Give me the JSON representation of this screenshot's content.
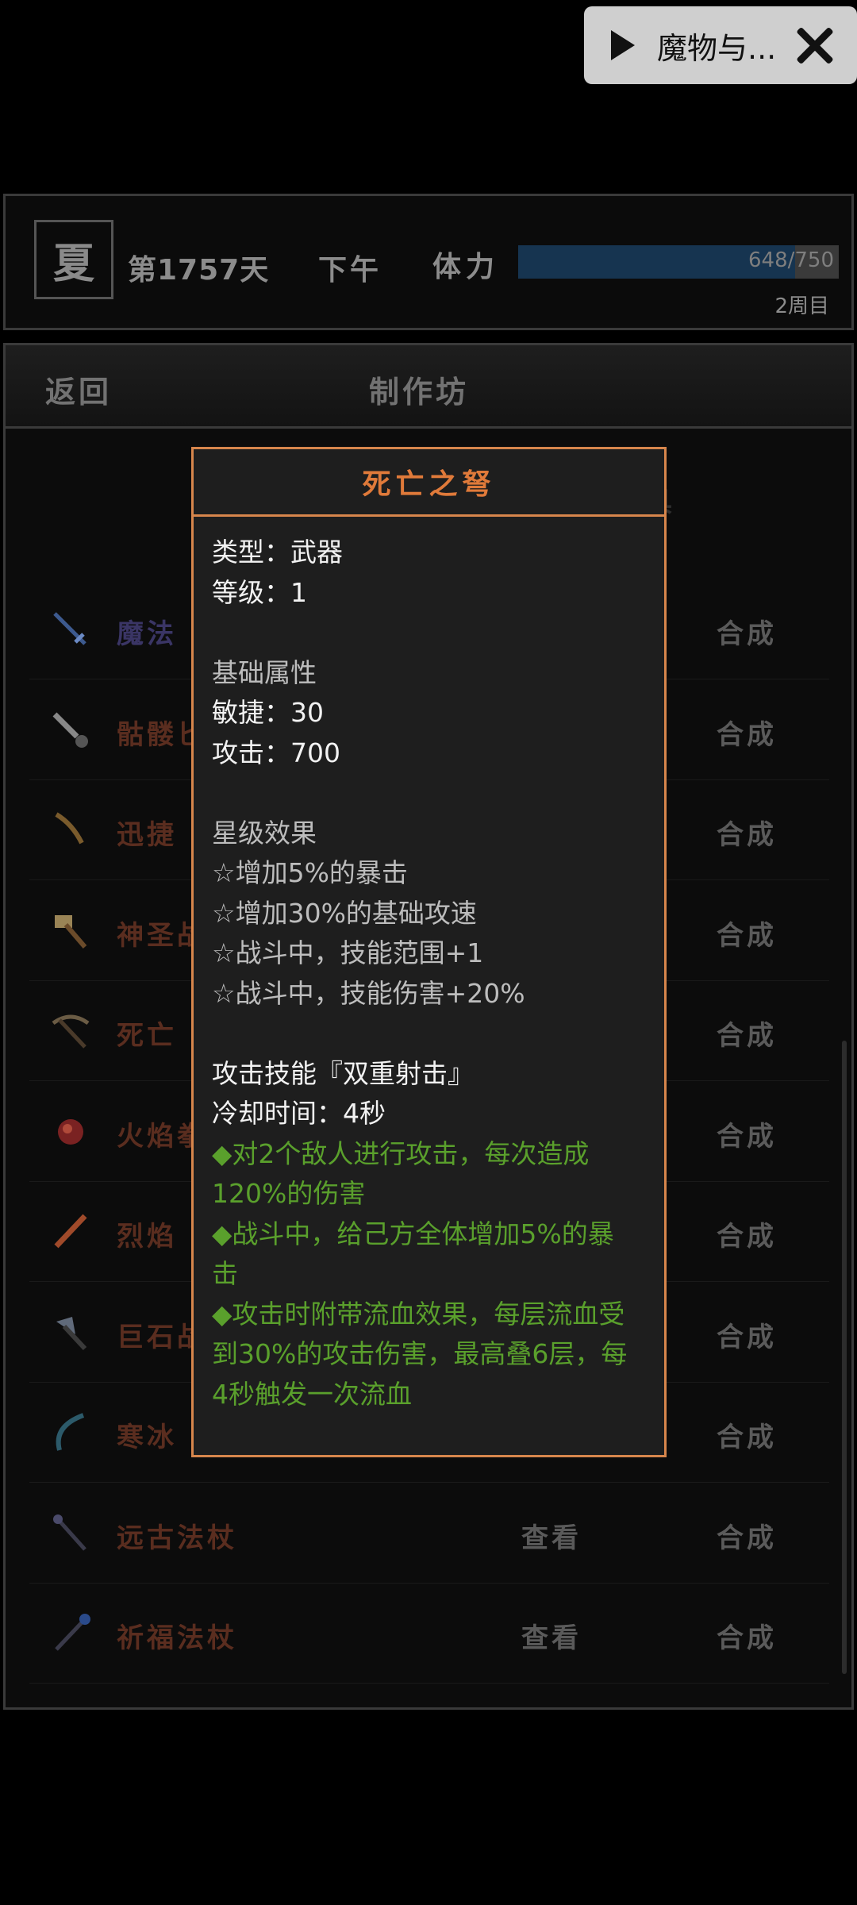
{
  "pill": {
    "icon": "play-icon",
    "title": "魔物与...",
    "close_icon": "close-icon"
  },
  "status": {
    "season": "夏",
    "day": "第1757天",
    "time_of_day": "下午",
    "stamina_label": "体力",
    "stamina_current": 648,
    "stamina_max": 750,
    "stamina_text": "648/750",
    "cycle": "2周目",
    "stamina_color": "#163450"
  },
  "panel": {
    "back_label": "返回",
    "title": "制作坊",
    "tab_ghost": "具",
    "rows": [
      {
        "icon": "blue-sword-icon",
        "name": "魔法",
        "view": "",
        "craft": "合成",
        "color": "blue"
      },
      {
        "icon": "skull-dagger-icon",
        "name": "骷髅匕",
        "view": "",
        "craft": "合成",
        "color": "brown"
      },
      {
        "icon": "swift-blade-icon",
        "name": "迅捷",
        "view": "",
        "craft": "合成",
        "color": "brown"
      },
      {
        "icon": "holy-hammer-icon",
        "name": "神圣战",
        "view": "",
        "craft": "合成",
        "color": "brown"
      },
      {
        "icon": "death-crossbow-icon",
        "name": "死亡",
        "view": "",
        "craft": "合成",
        "color": "brown"
      },
      {
        "icon": "flame-gauntlet-icon",
        "name": "火焰拳",
        "view": "",
        "craft": "合成",
        "color": "brown"
      },
      {
        "icon": "blazing-blade-icon",
        "name": "烈焰",
        "view": "",
        "craft": "合成",
        "color": "brown"
      },
      {
        "icon": "boulder-axe-icon",
        "name": "巨石战",
        "view": "",
        "craft": "合成",
        "color": "brown"
      },
      {
        "icon": "ice-bow-icon",
        "name": "寒冰",
        "view": "",
        "craft": "合成",
        "color": "brown"
      },
      {
        "icon": "ancient-staff-icon",
        "name": "远古法杖",
        "view": "查看",
        "craft": "合成",
        "color": "brown"
      },
      {
        "icon": "blessing-staff-icon",
        "name": "祈福法杖",
        "view": "查看",
        "craft": "合成",
        "color": "brown"
      }
    ]
  },
  "popup": {
    "title": "死亡之弩",
    "type_line": "类型：武器",
    "level_line": "等级：1",
    "base_header": "基础属性",
    "base_stats": [
      "敏捷：30",
      "攻击：700"
    ],
    "star_header": "星级效果",
    "star_effects": [
      "☆增加5%的暴击",
      "☆增加30%的基础攻速",
      "☆战斗中，技能范围+1",
      "☆战斗中，技能伤害+20%"
    ],
    "skill_header": "攻击技能『双重射击』",
    "cooldown": "冷却时间：4秒",
    "skill_lines": [
      "◆对2个敌人进行攻击，每次造成",
      "120%的伤害",
      "◆战斗中，给己方全体增加5%的暴",
      "击",
      "◆攻击时附带流血效果，每层流血受",
      "到30%的攻击伤害，最高叠6层，每",
      "4秒触发一次流血"
    ],
    "colors": {
      "border": "#d7864c",
      "title": "#e07a3a",
      "skill": "#5aa02c"
    }
  }
}
